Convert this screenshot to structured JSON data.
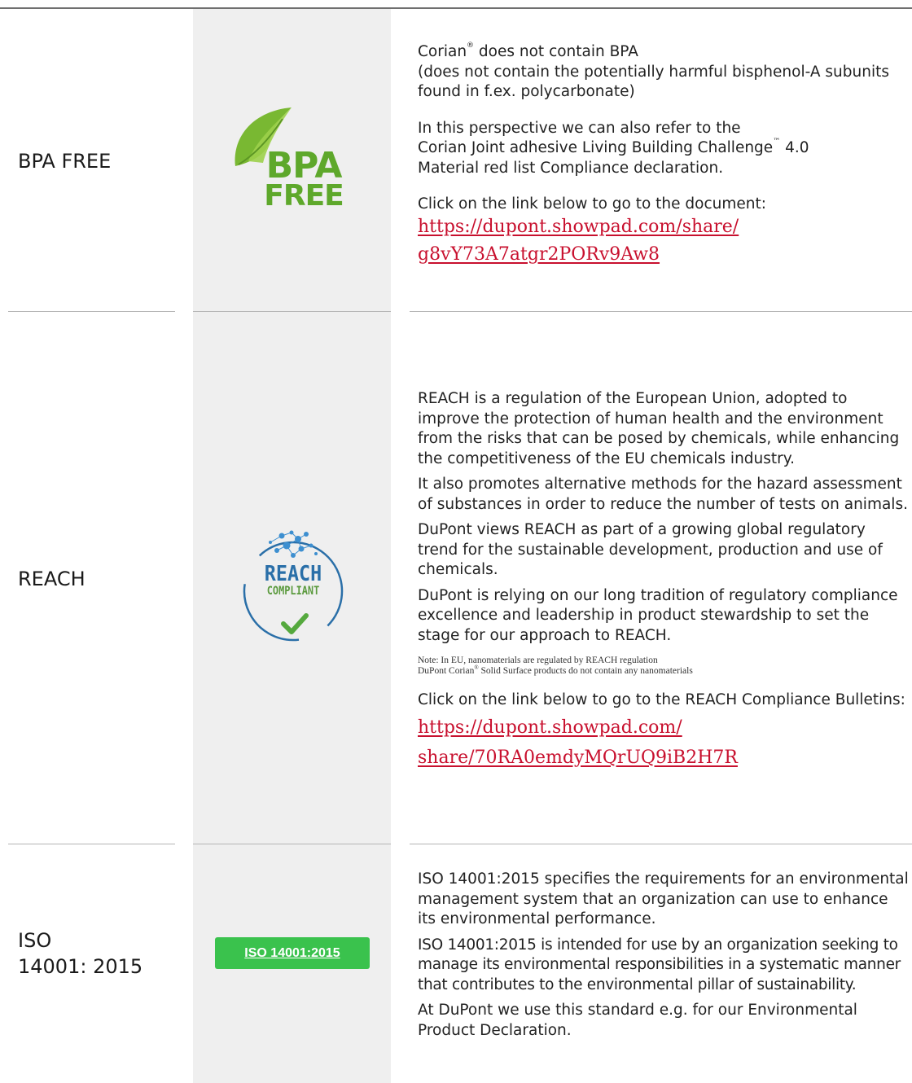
{
  "sections": {
    "bpa": {
      "label": "BPA FREE",
      "logo": {
        "icon": "bpa-free-leaf-logo",
        "line1": "BPA",
        "line2": "FREE",
        "leaf_color": "#79b832",
        "text_color": "#5ea82b"
      },
      "intro_a": "Corian",
      "intro_b": " does not contain BPA",
      "paren_line1": "(does not contain the potentially harmful bisphenol-A subunits",
      "paren_line2": "found in f.ex. polycarbonate)",
      "refer_line1": "In this perspective we can also refer to the",
      "refer_line2a": "Corian Joint adhesive Living Building Challenge",
      "refer_line2b": " 4.0",
      "refer_line3": "Material red list Compliance declaration.",
      "click_text": "Click on the link below to go to the document:",
      "link_line1": "https://dupont.showpad.com/share/",
      "link_line2": "g8vY73A7atgr2PORv9Aw8"
    },
    "reach": {
      "label": "REACH",
      "logo": {
        "icon": "reach-compliant-logo",
        "line1": "REACH",
        "line2": "COMPLIANT",
        "color": "#2a6fa8",
        "check_color": "#55a93e"
      },
      "p1": [
        "REACH is a regulation of the European Union, adopted to",
        "improve the protection of human health and the environment",
        "from the risks that can be posed by chemicals, while enhancing",
        "the competitiveness of the EU chemicals industry."
      ],
      "p2": [
        "It also promotes alternative methods for the hazard assessment",
        "of substances in order to reduce the number of tests on animals."
      ],
      "p3": [
        "DuPont views REACH as part of a growing global regulatory",
        "trend for the sustainable development, production and use of",
        "chemicals."
      ],
      "p4": [
        "DuPont is relying on our long tradition of regulatory compliance",
        "excellence and leadership in product stewardship to set the",
        "stage for our approach to REACH."
      ],
      "note_line1": "Note: In EU, nanomaterials are regulated by REACH regulation",
      "note_line2a": "DuPont Corian",
      "note_line2b": " Solid Surface products do not contain any nanomaterials",
      "click_text": "Click on the link below to go to the REACH Compliance Bulletins:",
      "link_line1": "https://dupont.showpad.com/",
      "link_line2": "share/70RA0emdyMQrUQ9iB2H7R"
    },
    "iso": {
      "label_line1": "ISO",
      "label_line2": "14001: 2015",
      "badge": "ISO 14001:2015",
      "badge_color": "#3ac24d",
      "p1": [
        "ISO 14001:2015 specifies the requirements for an environmental",
        "management system that an organization can use to enhance",
        "its environmental performance."
      ],
      "p2": [
        "ISO 14001:2015 is intended for use by an organization seeking to",
        "manage its environmental responsibilities in a systematic manner",
        "that contributes to the environmental pillar of sustainability."
      ],
      "p3": [
        "At DuPont we use this standard e.g. for our Environmental",
        "Product Declaration."
      ]
    }
  },
  "symbols": {
    "registered": "®",
    "trademark": "™"
  }
}
